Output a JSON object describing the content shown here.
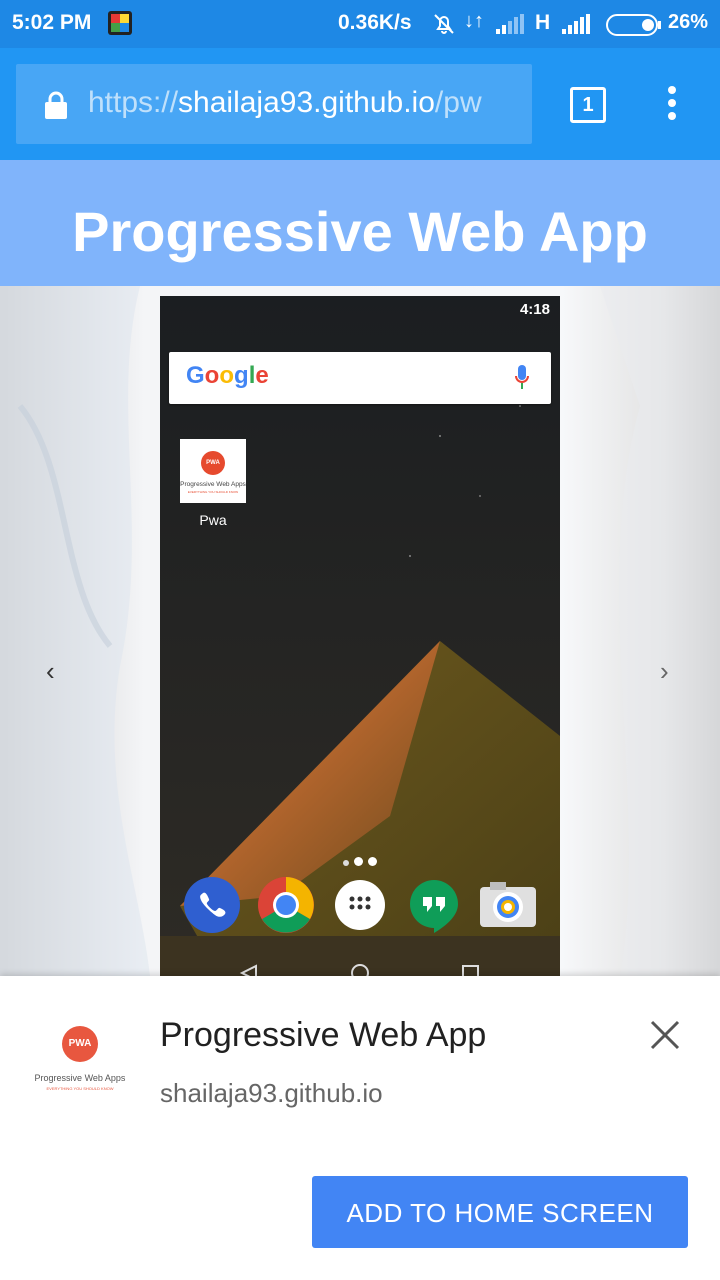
{
  "status_bar": {
    "time": "5:02 PM",
    "network_speed": "0.36K/s",
    "network_type": "H",
    "battery": "26%"
  },
  "toolbar": {
    "url_scheme": "https://",
    "url_host": "shailaja93.github.io",
    "url_path": "/pw",
    "tab_count": "1"
  },
  "page": {
    "header_title": "Progressive Web App"
  },
  "carousel": {
    "prev_label": "‹",
    "next_label": "›",
    "screenshot": {
      "time": "4:18",
      "search_logo": "Google",
      "app_tile_badge": "PWA",
      "app_tile_name": "Progressive Web Apps",
      "app_tile_tagline": "EVERYTHING YOU SHOULD KNOW",
      "app_label": "Pwa",
      "dock_icons": [
        "phone-icon",
        "chrome-icon",
        "app-drawer-icon",
        "hangouts-icon",
        "camera-icon"
      ]
    }
  },
  "install_sheet": {
    "icon_badge": "PWA",
    "icon_title": "Progressive Web Apps",
    "icon_tagline": "EVERYTHING YOU SHOULD KNOW",
    "app_name": "Progressive Web App",
    "origin": "shailaja93.github.io",
    "add_button_label": "ADD TO HOME SCREEN"
  },
  "colors": {
    "status_bar": "#1e88e5",
    "toolbar": "#2196f3",
    "page_header": "#80b4fb",
    "add_button": "#4285f4",
    "pwa_accent": "#e8573f"
  }
}
